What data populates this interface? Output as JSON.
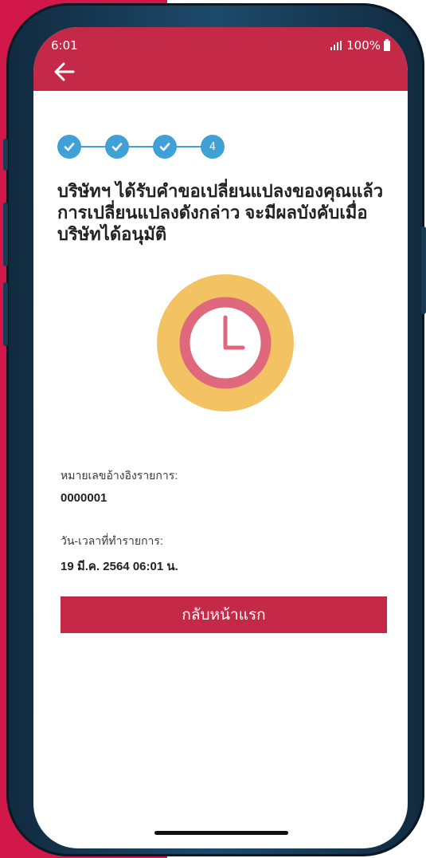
{
  "status_bar": {
    "time": "6:01",
    "battery": "100%",
    "icons": [
      "signal-icon",
      "battery-icon"
    ]
  },
  "app_bar": {
    "back_icon": "arrow-left-icon",
    "color": "#c42a47"
  },
  "stepper": {
    "steps": [
      {
        "state": "done",
        "icon": "check-icon"
      },
      {
        "state": "done",
        "icon": "check-icon"
      },
      {
        "state": "done",
        "icon": "check-icon"
      },
      {
        "state": "current",
        "label": "4"
      }
    ],
    "color": "#3fa1d6"
  },
  "message": {
    "text": "บริษัทฯ ได้รับคำขอเปลี่ยนแปลงของคุณแล้ว การเปลี่ยนแปลงดังกล่าว จะมีผลบังคับเมื่อบริษัทได้อนุมัติ"
  },
  "illustration": {
    "icon": "clock-icon",
    "outer_color": "#f3c263",
    "ring_color": "#e0687c"
  },
  "details": {
    "reference_label": "หมายเลขอ้างอิงรายการ:",
    "reference_value": "0000001",
    "datetime_label": "วัน-เวลาที่ทำรายการ:",
    "datetime_value": "19 มี.ค. 2564 06:01 น."
  },
  "actions": {
    "home_button_label": "กลับหน้าแรก"
  },
  "theme": {
    "accent": "#d2184a",
    "button": "#c42a47"
  }
}
